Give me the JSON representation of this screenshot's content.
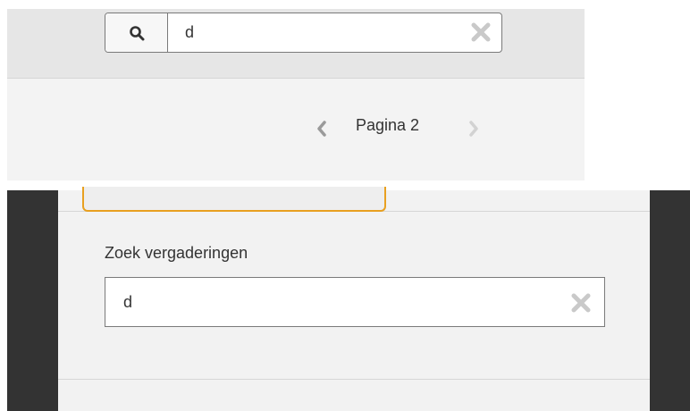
{
  "top": {
    "search": {
      "value": "d",
      "search_icon": "search-icon",
      "clear_icon": "clear-icon"
    },
    "pager": {
      "label": "Pagina 2",
      "prev_icon": "chevron-left-icon",
      "next_icon": "chevron-right-icon"
    }
  },
  "bottom": {
    "filter": {
      "label": "Zoek vergaderingen",
      "value": "d",
      "clear_icon": "clear-icon"
    }
  },
  "colors": {
    "tab_accent": "#e8a020",
    "dark_sidebar": "#333333",
    "panel_bg": "#f2f2f2"
  }
}
